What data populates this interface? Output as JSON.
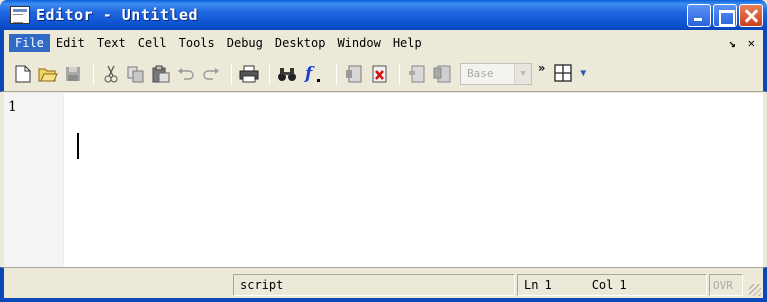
{
  "window": {
    "title": "Editor - Untitled"
  },
  "menu": {
    "items": [
      "File",
      "Edit",
      "Text",
      "Cell",
      "Tools",
      "Debug",
      "Desktop",
      "Window",
      "Help"
    ],
    "undock_glyph": "↘",
    "close_glyph": "✕"
  },
  "toolbar": {
    "base_select_value": "Base",
    "overflow_glyph": "»"
  },
  "editor": {
    "line_number": "1"
  },
  "statusbar": {
    "mode": "script",
    "ln_label": "Ln",
    "ln_value": "1",
    "col_label": "Col",
    "col_value": "1",
    "ovr": "OVR"
  },
  "colors": {
    "title_bar": "#0a5fd8",
    "menu_active": "#316ac5",
    "chrome": "#ece9d8"
  }
}
